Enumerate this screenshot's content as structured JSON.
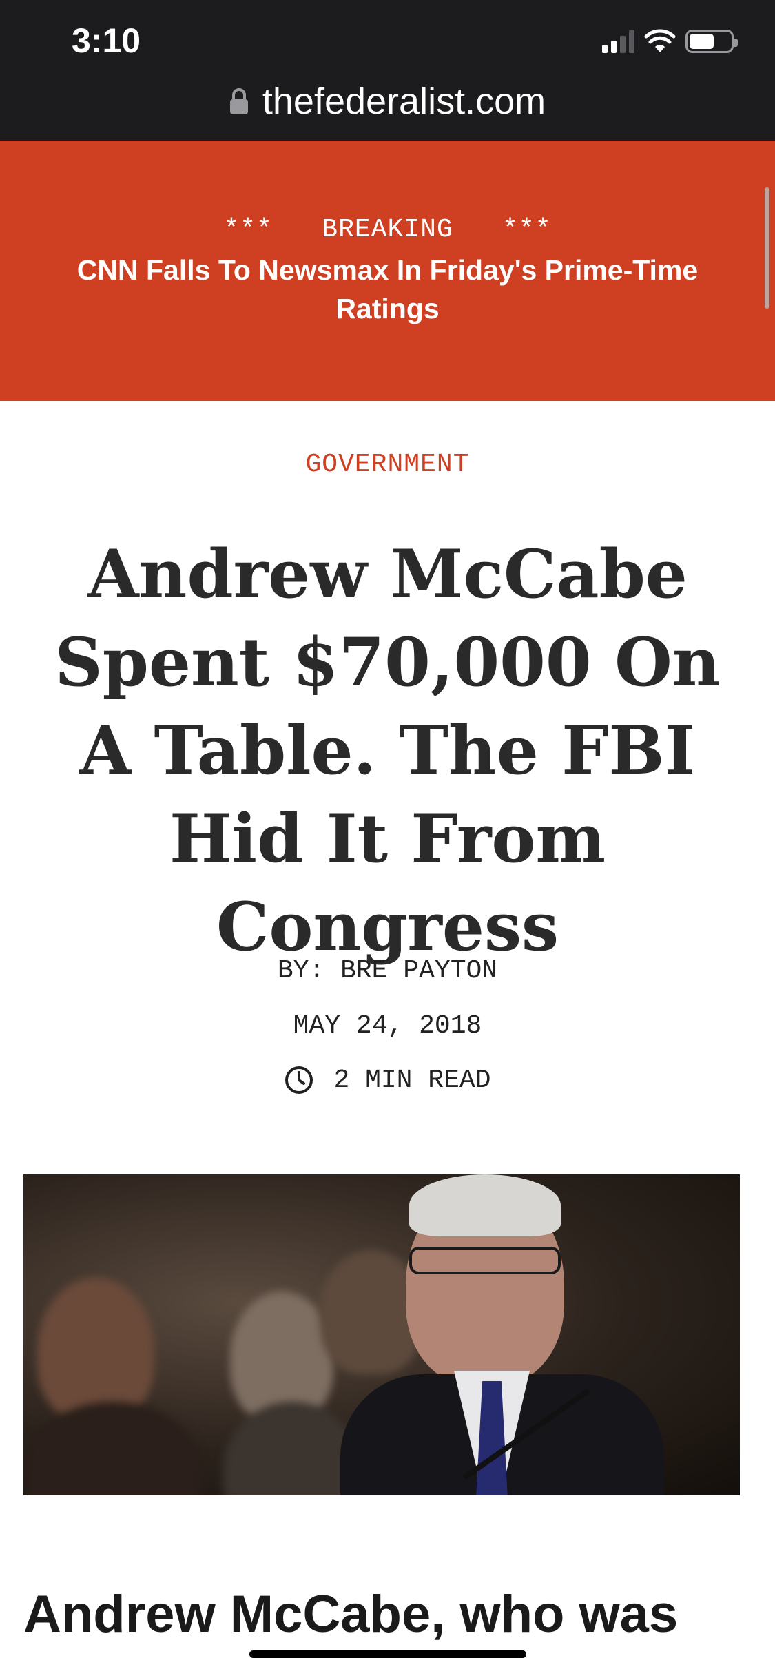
{
  "status_bar": {
    "time": "3:10"
  },
  "browser": {
    "url": "thefederalist.com"
  },
  "breaking": {
    "label": "***   BREAKING   ***",
    "headline": "CNN Falls To Newsmax In Friday's Prime-Time Ratings"
  },
  "article": {
    "category": "GOVERNMENT",
    "title": "Andrew McCabe Spent $70,000 On A Table. The FBI Hid It From Congress",
    "byline": "BY: BRE PAYTON",
    "date": "MAY 24, 2018",
    "read_time": "2 MIN READ",
    "body_start": "Andrew McCabe, who was"
  },
  "colors": {
    "accent": "#cf3f21",
    "chrome": "#1c1c1e"
  },
  "icons": {
    "lock": "lock-icon",
    "clock": "clock-icon",
    "wifi": "wifi-icon",
    "signal": "signal-icon",
    "battery": "battery-icon"
  }
}
